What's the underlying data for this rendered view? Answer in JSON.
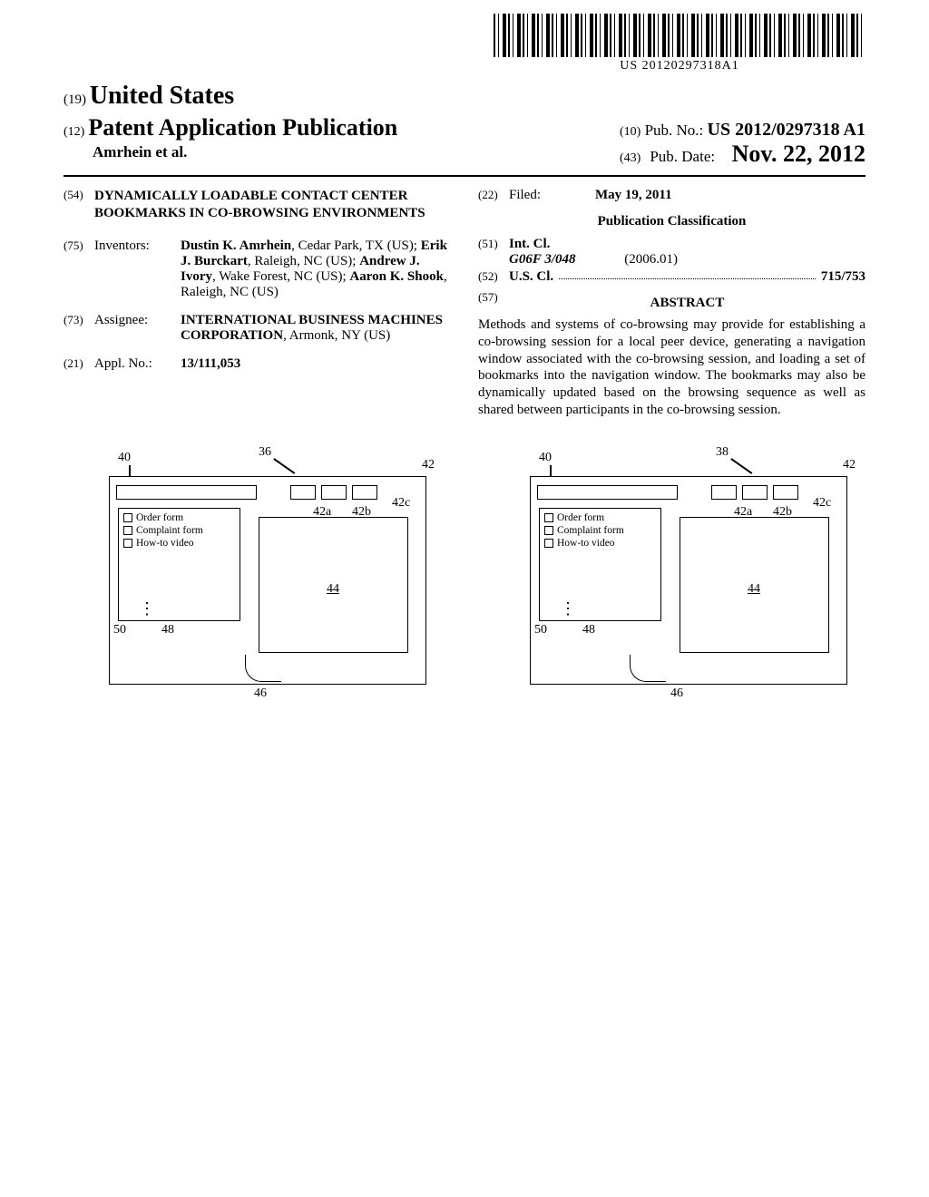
{
  "barcode_caption": "US 20120297318A1",
  "header": {
    "country_code": "(19)",
    "country": "United States",
    "pub_type_code": "(12)",
    "pub_type": "Patent Application Publication",
    "authors_line": "Amrhein et al.",
    "pub_no_code": "(10)",
    "pub_no_label": "Pub. No.:",
    "pub_no_value": "US 2012/0297318 A1",
    "pub_date_code": "(43)",
    "pub_date_label": "Pub. Date:",
    "pub_date_value": "Nov. 22, 2012"
  },
  "left_col": {
    "title_code": "(54)",
    "title": "DYNAMICALLY LOADABLE CONTACT CENTER BOOKMARKS IN CO-BROWSING ENVIRONMENTS",
    "inventors_code": "(75)",
    "inventors_label": "Inventors:",
    "inventors_html": "Dustin K. Amrhein, Cedar Park, TX (US); Erik J. Burckart, Raleigh, NC (US); Andrew J. Ivory, Wake Forest, NC (US); Aaron K. Shook, Raleigh, NC (US)",
    "assignee_code": "(73)",
    "assignee_label": "Assignee:",
    "assignee_value": "INTERNATIONAL BUSINESS MACHINES CORPORATION, Armonk, NY (US)",
    "appl_code": "(21)",
    "appl_label": "Appl. No.:",
    "appl_value": "13/111,053"
  },
  "right_col": {
    "filed_code": "(22)",
    "filed_label": "Filed:",
    "filed_value": "May 19, 2011",
    "pub_class_heading": "Publication Classification",
    "intcl_code": "(51)",
    "intcl_label": "Int. Cl.",
    "intcl_class": "G06F 3/048",
    "intcl_date": "(2006.01)",
    "uscl_code": "(52)",
    "uscl_label": "U.S. Cl.",
    "uscl_value": "715/753",
    "abstract_code": "(57)",
    "abstract_heading": "ABSTRACT",
    "abstract_text": "Methods and systems of co-browsing may provide for establishing a co-browsing session for a local peer device, generating a navigation window associated with the co-browsing session, and loading a set of bookmarks into the navigation window. The bookmarks may also be dynamically updated based on the browsing sequence as well as shared between participants in the co-browsing session."
  },
  "figure": {
    "ref_36": "36",
    "ref_38": "38",
    "ref_40": "40",
    "ref_42": "42",
    "ref_42a": "42a",
    "ref_42b": "42b",
    "ref_42c": "42c",
    "ref_44": "44",
    "ref_46": "46",
    "ref_48": "48",
    "ref_50": "50",
    "sidebar_items": [
      "Order form",
      "Complaint form",
      "How-to video"
    ]
  }
}
